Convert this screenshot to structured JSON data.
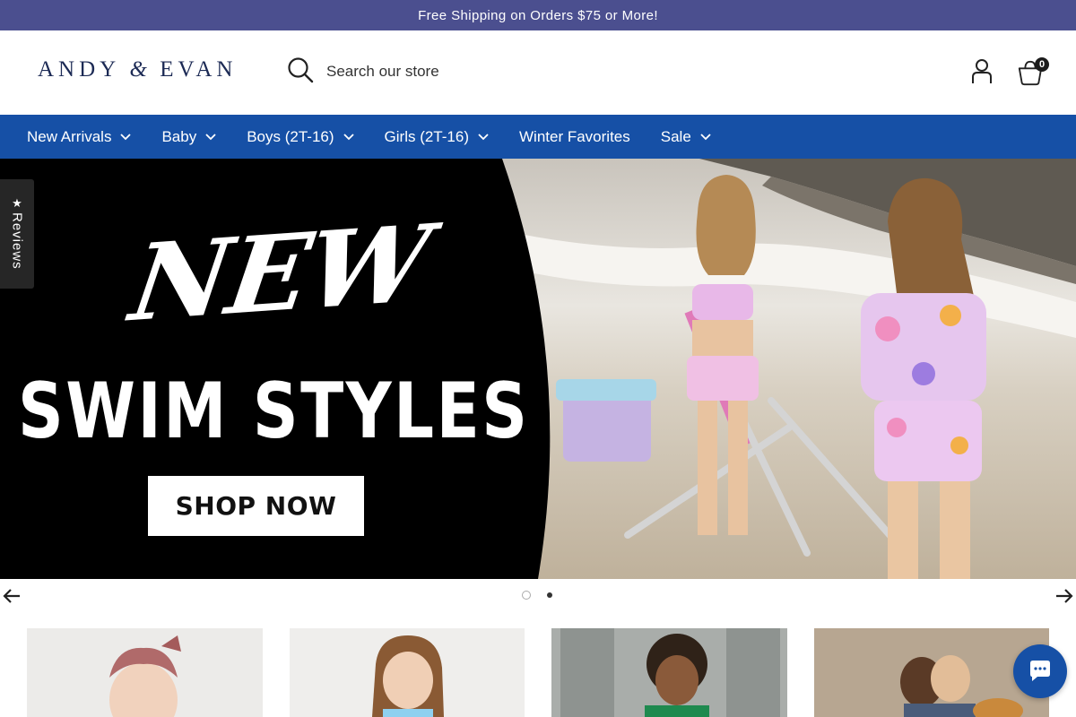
{
  "announcement": {
    "text": "Free Shipping on Orders $75 or More!"
  },
  "header": {
    "logo_left": "ANDY",
    "logo_amp": "&",
    "logo_right": "EVAN",
    "search_placeholder": "Search our store",
    "account_icon": "account-icon",
    "cart_icon": "cart-icon",
    "cart_count": "0"
  },
  "nav": {
    "items": [
      {
        "label": "New Arrivals",
        "has_dropdown": true
      },
      {
        "label": "Baby",
        "has_dropdown": true
      },
      {
        "label": "Boys (2T-16)",
        "has_dropdown": true
      },
      {
        "label": "Girls (2T-16)",
        "has_dropdown": true
      },
      {
        "label": "Winter Favorites",
        "has_dropdown": false
      },
      {
        "label": "Sale",
        "has_dropdown": true
      }
    ]
  },
  "hero": {
    "headline_script": "NEW",
    "headline_block": "SWIM STYLES",
    "cta_label": "SHOP NOW"
  },
  "reviews_tab": {
    "label": "Reviews",
    "icon": "star-icon"
  },
  "slider": {
    "slide_count": 2,
    "active_slide": 1
  },
  "colors": {
    "announcement_bg": "#4b4f8f",
    "nav_bg": "#1650a6",
    "logo": "#1c2a55",
    "chat_bg": "#1650a6"
  }
}
